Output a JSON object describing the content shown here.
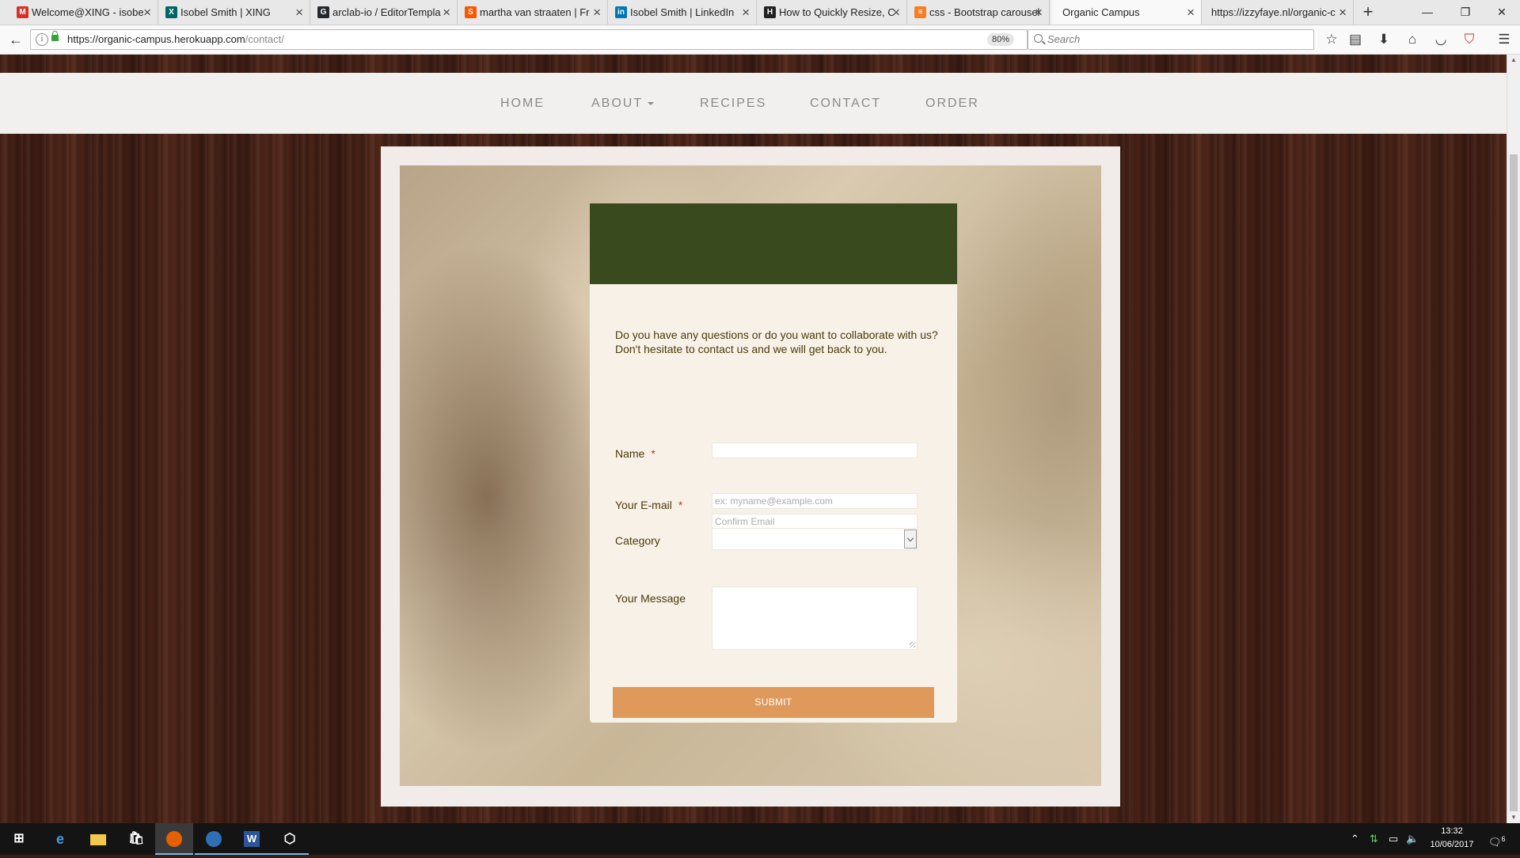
{
  "browser": {
    "tabs": [
      {
        "title": "Welcome@XING - isobe",
        "icon": "gmail-icon",
        "color": "#d93025"
      },
      {
        "title": "Isobel Smith | XING",
        "icon": "xing-icon",
        "color": "#006567"
      },
      {
        "title": "arclab-io / EditorTempla",
        "icon": "github-icon",
        "color": "#24292e"
      },
      {
        "title": "martha van straaten | Fr",
        "icon": "soundcloud-icon",
        "color": "#ff5500"
      },
      {
        "title": "Isobel Smith | LinkedIn",
        "icon": "linkedin-icon",
        "color": "#0077b5"
      },
      {
        "title": "How to Quickly Resize, C",
        "icon": "htg-icon",
        "color": "#222222"
      },
      {
        "title": "css - Bootstrap carousel",
        "icon": "stackoverflow-icon",
        "color": "#f48024"
      },
      {
        "title": "Organic Campus",
        "icon": "",
        "color": ""
      },
      {
        "title": "https://izzyfaye.nl/organic-c",
        "icon": "",
        "color": ""
      }
    ],
    "active_tab": 7,
    "url_host": "https://organic-campus.herokuapp.com",
    "url_path": "/contact/",
    "zoom": "80%",
    "search_placeholder": "Search"
  },
  "site": {
    "nav": [
      {
        "label": "HOME"
      },
      {
        "label": "ABOUT",
        "dropdown": true
      },
      {
        "label": "RECIPES"
      },
      {
        "label": "CONTACT"
      },
      {
        "label": "ORDER"
      }
    ],
    "colors": {
      "header_green": "#3a4a1f",
      "submit_orange": "#df9a5b",
      "card_bg": "#f8f1e7"
    }
  },
  "form": {
    "intro": "Do you have any questions or do you want to collaborate with us? Don't hesitate to contact us and we will get back to you.",
    "name_label": "Name",
    "required_mark": "*",
    "email_label": "Your E-mail",
    "email_placeholder": "ex: myname@example.com",
    "confirm_placeholder": "Confirm Email",
    "category_label": "Category",
    "category_value": "",
    "message_label": "Your Message",
    "submit_label": "SUBMIT"
  },
  "taskbar": {
    "apps": [
      "start-icon",
      "edge-icon",
      "file-explorer-icon",
      "store-icon",
      "firefox-icon",
      "thunderbird-icon",
      "word-icon",
      "virtualbox-icon"
    ],
    "time": "13:32",
    "date": "10/06/2017",
    "notification_count": "6"
  }
}
